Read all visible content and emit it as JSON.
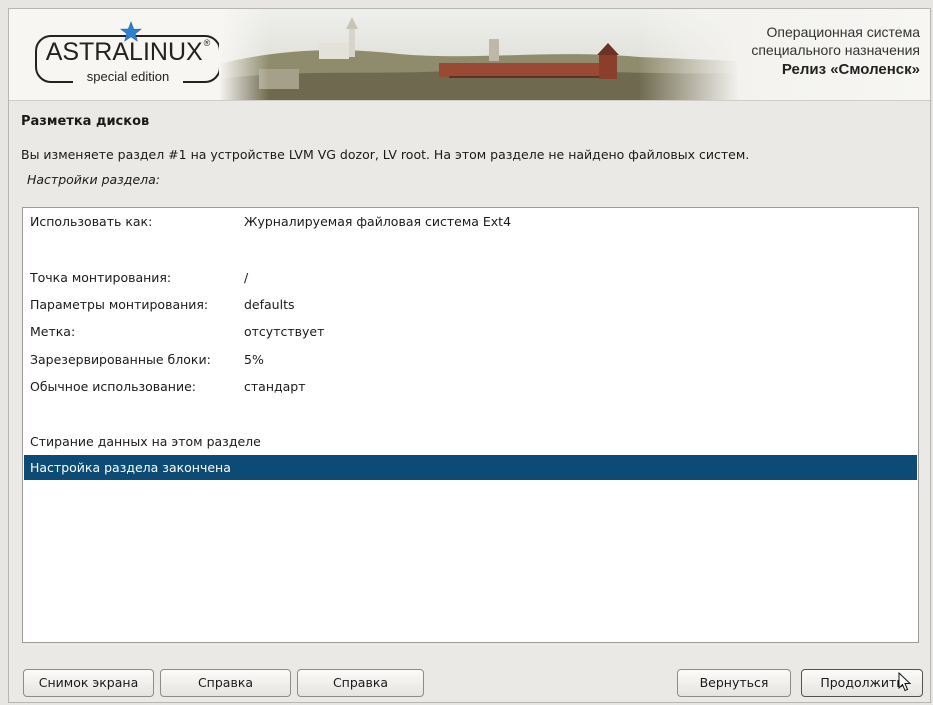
{
  "banner": {
    "logo_text": "ASTRALINUX",
    "logo_reg": "®",
    "logo_sub": "special edition",
    "tagline_line1": "Операционная система",
    "tagline_line2": "специального назначения",
    "tagline_line3": "Релиз «Смоленск»"
  },
  "page": {
    "title": "Разметка дисков",
    "description": "Вы изменяете раздел #1 на устройстве LVM VG dozor, LV root. На этом разделе не найдено файловых систем.",
    "subheading": "Настройки раздела:"
  },
  "settings": [
    {
      "key": "Использовать как:",
      "value": "Журналируемая файловая система Ext4"
    },
    {
      "key": "Точка монтирования:",
      "value": "/"
    },
    {
      "key": "Параметры монтирования:",
      "value": "defaults"
    },
    {
      "key": "Метка:",
      "value": "отсутствует"
    },
    {
      "key": "Зарезервированные блоки:",
      "value": "5%"
    },
    {
      "key": "Обычное использование:",
      "value": "стандарт"
    }
  ],
  "actions": {
    "erase": "Стирание данных на этом разделе",
    "done": "Настройка раздела закончена"
  },
  "buttons": {
    "screenshot": "Снимок экрана",
    "help1": "Справка",
    "help2": "Справка",
    "back": "Вернуться",
    "continue": "Продолжить"
  },
  "colors": {
    "selection": "#0d4b77",
    "star": "#2f7fd1"
  },
  "icons": {
    "logo_star": "star-icon",
    "cursor": "mouse-pointer-icon"
  }
}
